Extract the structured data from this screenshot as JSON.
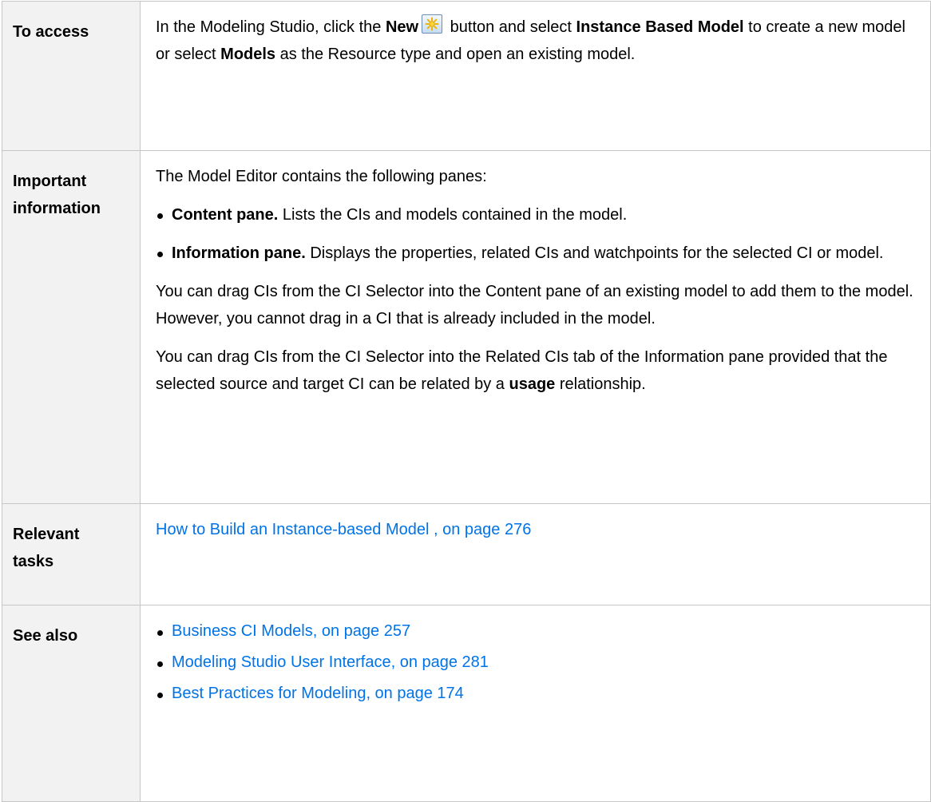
{
  "rows": {
    "to_access": {
      "label": "To access",
      "text_1": "In the Modeling Studio, click the ",
      "new_bold": "New",
      "new_icon": "new-star-icon",
      "text_2": " button and select ",
      "instance_bold": "Instance Based Model",
      "text_3": " to create a new model or select ",
      "models_bold": "Models",
      "text_4": " as the Resource type and open an existing model."
    },
    "important": {
      "label_line1": "Important",
      "label_line2": "information",
      "intro": "The Model Editor contains the following panes:",
      "bullets": [
        {
          "bold": "Content pane.",
          "text": " Lists the CIs and models contained in the model."
        },
        {
          "bold": "Information pane.",
          "text": " Displays the properties, related CIs and watchpoints for the selected CI or model."
        }
      ],
      "para_1": "You can drag CIs from the CI Selector into the Content pane of an existing model to add them to the model. However, you cannot drag in a CI that is already included in the model.",
      "para_2_text": "You can drag CIs from the CI Selector into the Related CIs tab of the Information pane provided that the selected source and target CI can be related by a ",
      "para_2_bold": "usage",
      "para_2_end": " relationship."
    },
    "relevant_tasks": {
      "label_line1": "Relevant",
      "label_line2": "tasks",
      "link": "How to Build an Instance-based Model , on page 276"
    },
    "see_also": {
      "label": "See also",
      "links": [
        "Business CI Models, on page 257",
        "Modeling Studio User Interface, on page 281",
        "Best Practices for Modeling, on page 174"
      ]
    }
  },
  "colors": {
    "label_background": "#f2f2f2",
    "border": "#c6c6c6",
    "link": "#0073e7",
    "text": "#000000"
  }
}
